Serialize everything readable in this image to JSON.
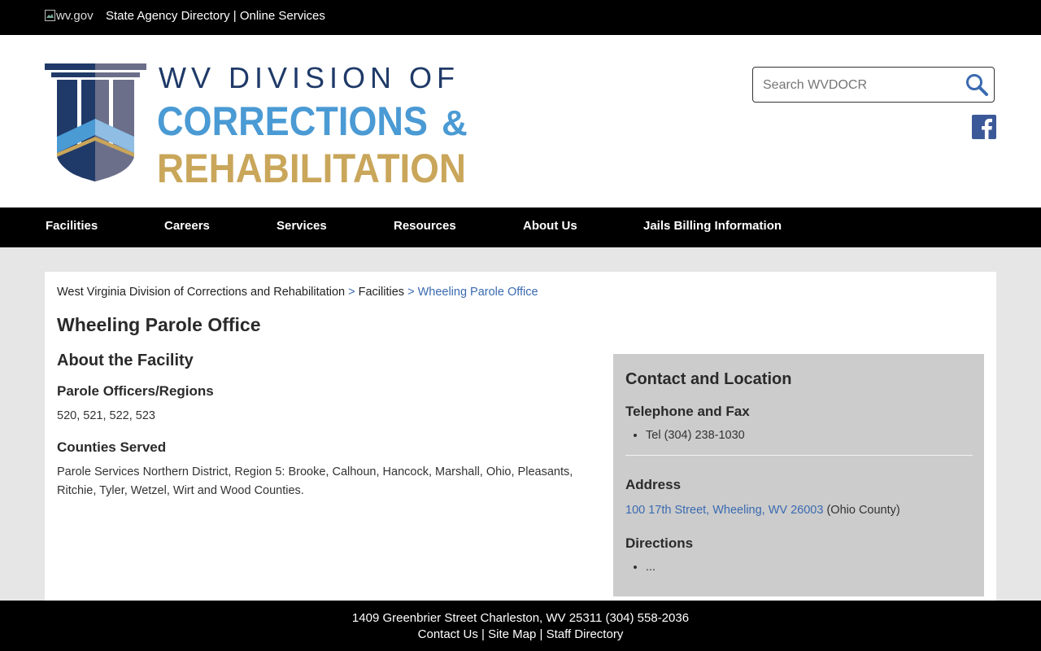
{
  "topbar": {
    "wvgov_alt": "wv.gov",
    "agency_directory": "State Agency Directory",
    "separator": "|",
    "online_services": "Online Services"
  },
  "logo": {
    "line1": "WV DIVISION OF",
    "line2": "CORRECTIONS",
    "amp": "&",
    "line3": "REHABILITATION",
    "colors": {
      "navy": "#1f3a68",
      "blue": "#4a9ad4",
      "gold": "#c9a65a",
      "slate": "#6b6f8a",
      "light_blue": "#8fbde4"
    }
  },
  "search": {
    "placeholder": "Search WVDOCR",
    "icon": "search-icon"
  },
  "social": {
    "facebook_icon": "facebook-icon",
    "facebook_color": "#3b5998"
  },
  "nav": {
    "items": [
      {
        "label": "Facilities"
      },
      {
        "label": "Careers"
      },
      {
        "label": "Services"
      },
      {
        "label": "Resources"
      },
      {
        "label": "About Us"
      },
      {
        "label": "Jails Billing Information"
      }
    ]
  },
  "breadcrumb": {
    "items": [
      "West Virginia Division of Corrections and Rehabilitation",
      "Facilities",
      "Wheeling Parole Office"
    ],
    "separator": ">"
  },
  "page": {
    "title": "Wheeling Parole Office"
  },
  "about": {
    "heading": "About the Facility",
    "officers_heading": "Parole Officers/Regions",
    "officers_value": "520, 521, 522, 523",
    "counties_heading": "Counties Served",
    "counties_value": "Parole Services Northern District, Region 5: Brooke, Calhoun, Hancock, Marshall, Ohio, Pleasants, Ritchie, Tyler, Wetzel, Wirt and Wood Counties."
  },
  "contact": {
    "heading": "Contact and Location",
    "phone_heading": "Telephone and Fax",
    "phone_items": [
      "Tel (304) 238-1030"
    ],
    "address_heading": "Address",
    "address_link": "100 17th Street, Wheeling, WV 26003",
    "address_county": "(Ohio County)",
    "directions_heading": "Directions",
    "directions_items": [
      "..."
    ]
  },
  "footer": {
    "address": "1409 Greenbrier Street Charleston, WV 25311 (304) 558-2036",
    "links": [
      "Contact Us",
      "Site Map",
      "Staff Directory"
    ],
    "separator": "|"
  }
}
